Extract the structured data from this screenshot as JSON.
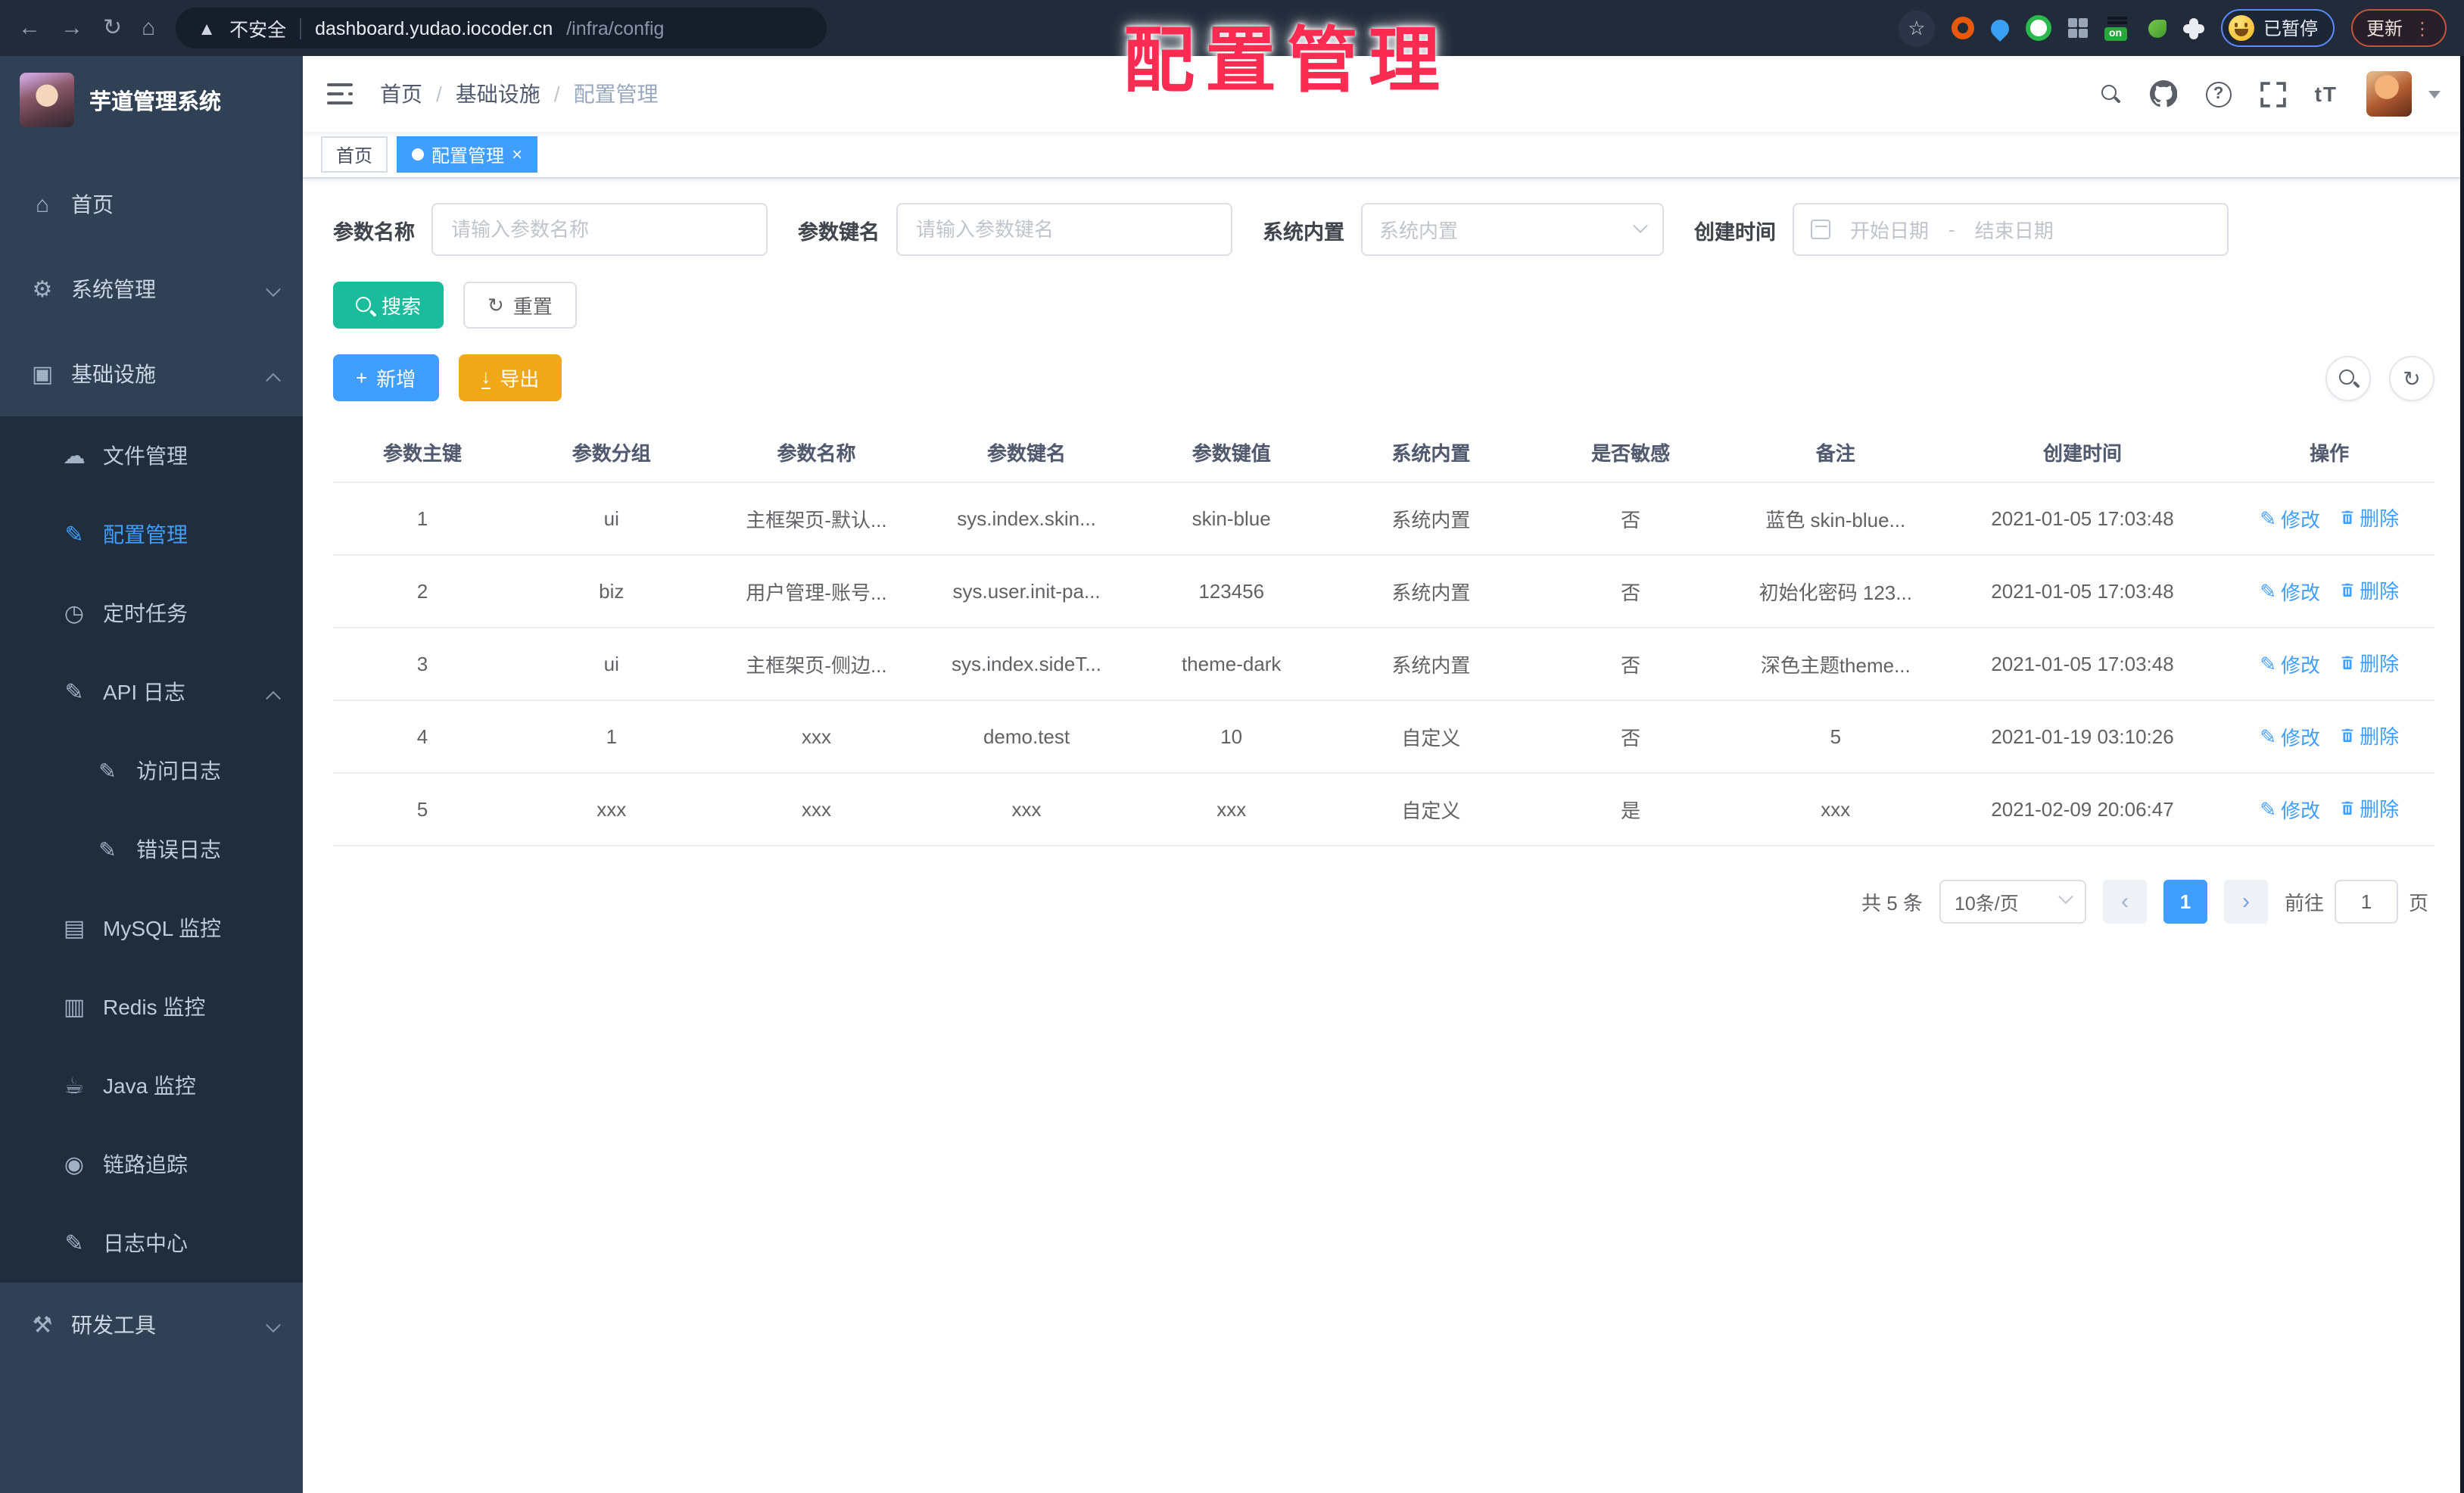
{
  "browser": {
    "security_label": "不安全",
    "url_host": "dashboard.yudao.iocoder.cn",
    "url_path": "/infra/config",
    "paused_label": "已暂停",
    "update_label": "更新"
  },
  "overlay_title": "配置管理",
  "sidebar": {
    "app_title": "芋道管理系统",
    "items": [
      {
        "label": "首页"
      },
      {
        "label": "系统管理"
      },
      {
        "label": "基础设施"
      },
      {
        "label": "文件管理"
      },
      {
        "label": "配置管理"
      },
      {
        "label": "定时任务"
      },
      {
        "label": "API 日志"
      },
      {
        "label": "访问日志"
      },
      {
        "label": "错误日志"
      },
      {
        "label": "MySQL 监控"
      },
      {
        "label": "Redis 监控"
      },
      {
        "label": "Java 监控"
      },
      {
        "label": "链路追踪"
      },
      {
        "label": "日志中心"
      },
      {
        "label": "研发工具"
      }
    ]
  },
  "navbar": {
    "breadcrumb": [
      "首页",
      "基础设施",
      "配置管理"
    ],
    "breadcrumb_sep": "/",
    "font_size_label": "tT"
  },
  "tabs": [
    {
      "label": "首页"
    },
    {
      "label": "配置管理",
      "close": "×"
    }
  ],
  "filters": {
    "name_label": "参数名称",
    "name_placeholder": "请输入参数名称",
    "key_label": "参数键名",
    "key_placeholder": "请输入参数键名",
    "builtin_label": "系统内置",
    "builtin_placeholder": "系统内置",
    "date_label": "创建时间",
    "date_start": "开始日期",
    "date_sep": "-",
    "date_end": "结束日期",
    "search_label": "搜索",
    "reset_label": "重置"
  },
  "toolbar": {
    "add_label": "新增",
    "export_label": "导出"
  },
  "table": {
    "columns": [
      "参数主键",
      "参数分组",
      "参数名称",
      "参数键名",
      "参数键值",
      "系统内置",
      "是否敏感",
      "备注",
      "创建时间",
      "操作"
    ],
    "edit_label": "修改",
    "delete_label": "删除",
    "rows": [
      {
        "id": "1",
        "group": "ui",
        "name": "主框架页-默认...",
        "key": "sys.index.skin...",
        "value": "skin-blue",
        "builtin": "系统内置",
        "sensitive": "否",
        "remark": "蓝色 skin-blue...",
        "created": "2021-01-05 17:03:48"
      },
      {
        "id": "2",
        "group": "biz",
        "name": "用户管理-账号...",
        "key": "sys.user.init-pa...",
        "value": "123456",
        "builtin": "系统内置",
        "sensitive": "否",
        "remark": "初始化密码 123...",
        "created": "2021-01-05 17:03:48"
      },
      {
        "id": "3",
        "group": "ui",
        "name": "主框架页-侧边...",
        "key": "sys.index.sideT...",
        "value": "theme-dark",
        "builtin": "系统内置",
        "sensitive": "否",
        "remark": "深色主题theme...",
        "created": "2021-01-05 17:03:48"
      },
      {
        "id": "4",
        "group": "1",
        "name": "xxx",
        "key": "demo.test",
        "value": "10",
        "builtin": "自定义",
        "sensitive": "否",
        "remark": "5",
        "created": "2021-01-19 03:10:26"
      },
      {
        "id": "5",
        "group": "xxx",
        "name": "xxx",
        "key": "xxx",
        "value": "xxx",
        "builtin": "自定义",
        "sensitive": "是",
        "remark": "xxx",
        "created": "2021-02-09 20:06:47"
      }
    ]
  },
  "pagination": {
    "total": "共 5 条",
    "size": "10条/页",
    "prev": "‹",
    "next": "›",
    "page": "1",
    "goto": "前往",
    "goto_value": "1",
    "unit": "页"
  },
  "colors": {
    "accent": "#409EFF",
    "search_button": "#1ABC9C",
    "export_button": "#F0A818",
    "overlay_text": "#FB2B52",
    "sidebar_bg": "#304156",
    "sidebar_submenu_bg": "#1F2D3D",
    "chrome_bg": "#222B3A"
  }
}
